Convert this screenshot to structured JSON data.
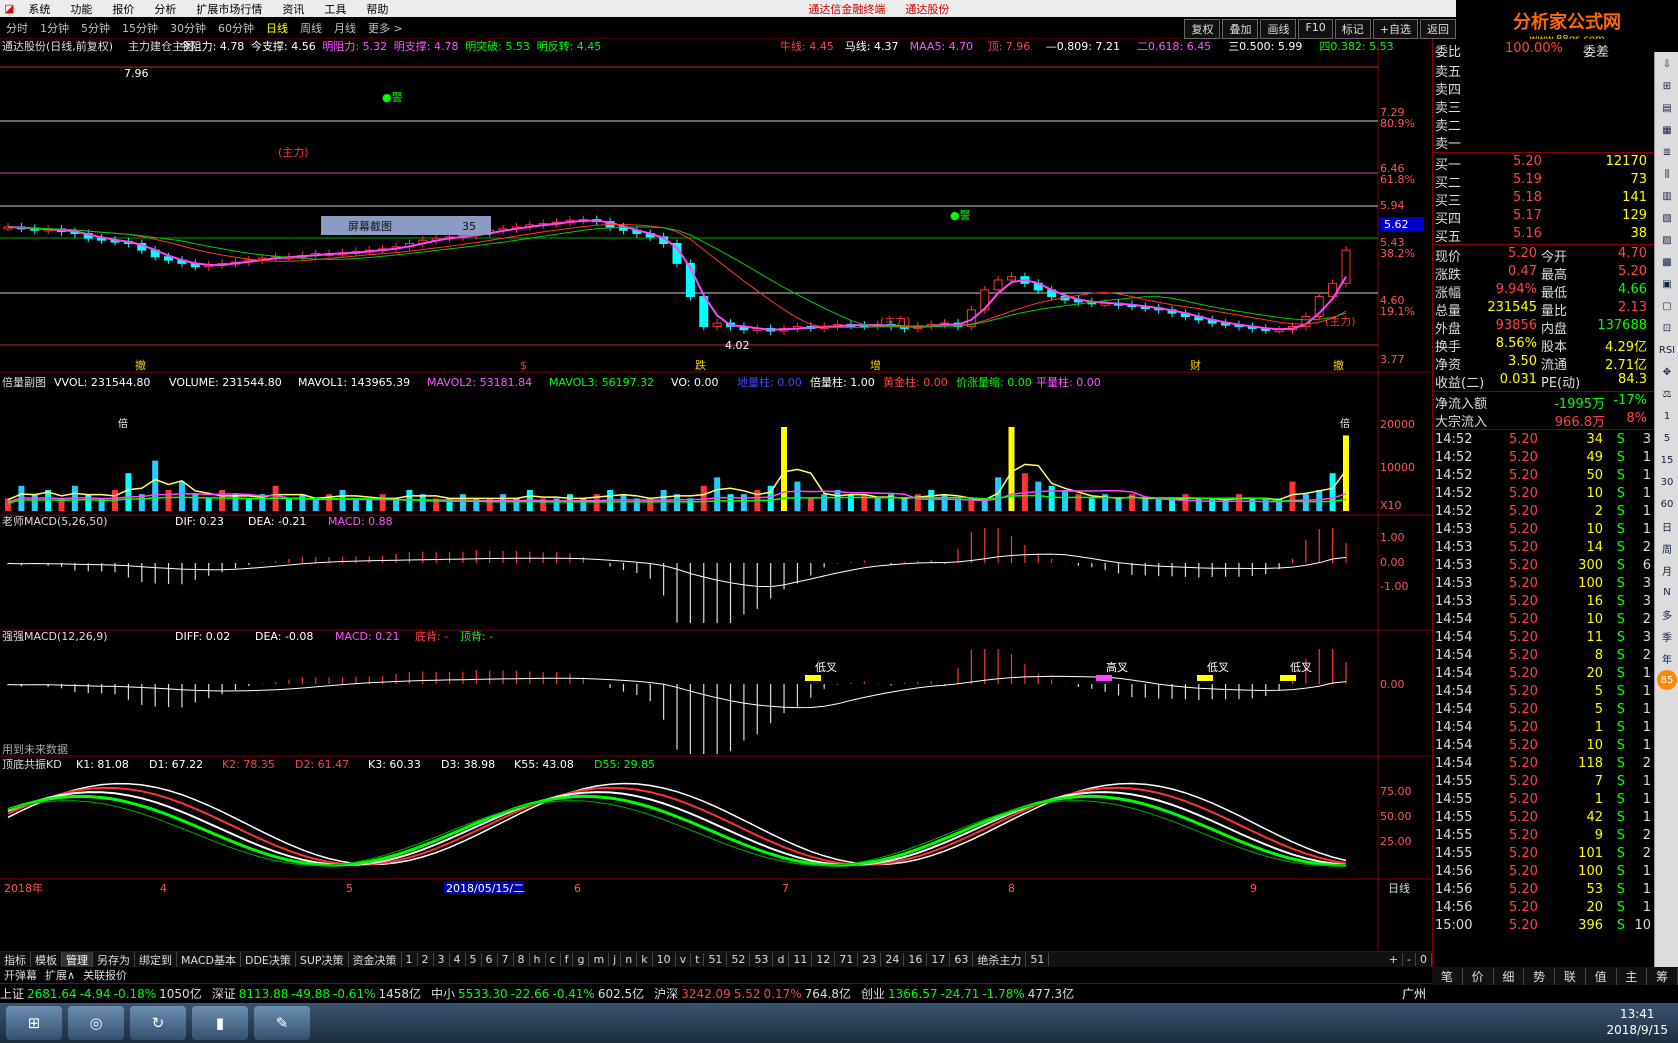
{
  "menu": {
    "items": [
      "系统",
      "功能",
      "报价",
      "分析",
      "扩展市场行情",
      "资讯",
      "工具",
      "帮助"
    ],
    "center": [
      "通达信金融终端",
      "通达股份"
    ]
  },
  "periods": {
    "items": [
      "分时",
      "1分钟",
      "5分钟",
      "15分钟",
      "30分钟",
      "60分钟",
      "日线",
      "周线",
      "月线",
      "更多 >"
    ],
    "selected": "日线"
  },
  "toolbar": {
    "items": [
      "复权",
      "叠加",
      "画线",
      "F10",
      "标记",
      "+自选",
      "返回"
    ]
  },
  "logo": {
    "text": "分析家公式网",
    "url": "www.88gs.com"
  },
  "main_chart": {
    "title": "通达股份(日线,前复权)",
    "legend": [
      {
        "t": "主力建仓主图",
        "c": "#dddddd"
      },
      {
        "t": "今阻力: 4.78",
        "c": "#ffffff"
      },
      {
        "t": "今支撑: 4.56",
        "c": "#ffffff"
      },
      {
        "t": "明阻力: 5.32",
        "c": "#ff55ff"
      },
      {
        "t": "明支撑: 4.78",
        "c": "#ff55ff"
      },
      {
        "t": "明突破: 5.53",
        "c": "#00ff00"
      },
      {
        "t": "明反转: 4.45",
        "c": "#00ff00"
      },
      {
        "t": "牛线: 4.45",
        "c": "#ff4444"
      },
      {
        "t": "马线: 4.37",
        "c": "#ffffff"
      },
      {
        "t": "MAA5: 4.70",
        "c": "#ff55ff"
      },
      {
        "t": "顶: 7.96",
        "c": "#ff4444"
      },
      {
        "t": "—0.809: 7.21",
        "c": "#ffffff"
      },
      {
        "t": "二0.618: 6.45",
        "c": "#ff55ff"
      },
      {
        "t": "三0.500: 5.99",
        "c": "#ffffff"
      },
      {
        "t": "四0.382: 5.53",
        "c": "#00ff00"
      }
    ],
    "price_axis": [
      "7.29",
      "80.9%",
      "6.46",
      "61.8%",
      "5.94",
      "5.43",
      "38.2%",
      "4.60",
      "19.1%",
      "3.77"
    ],
    "crosshair_price": "5.62",
    "high_label": "7.96",
    "low_label": "4.02",
    "marks": [
      "●警",
      "●警"
    ],
    "main_force_label": "(主力)",
    "bottom_signals": [
      "撤",
      "$",
      "跌",
      "增",
      "财",
      "撤"
    ],
    "screenshot_box": {
      "label": "屏幕截图",
      "count": "35"
    }
  },
  "volume": {
    "title": "倍量副图",
    "legend": [
      {
        "t": "VVOL: 231544.80",
        "c": "#ffffff"
      },
      {
        "t": "VOLUME: 231544.80",
        "c": "#ffffff"
      },
      {
        "t": "MAVOL1: 143965.39",
        "c": "#ffffff"
      },
      {
        "t": "MAVOL2: 53181.84",
        "c": "#ff55ff"
      },
      {
        "t": "MAVOL3: 56197.32",
        "c": "#00ff00"
      },
      {
        "t": "VO: 0.00",
        "c": "#ffffff"
      },
      {
        "t": "地量柱: 0.00",
        "c": "#4444ff"
      },
      {
        "t": "倍量柱: 1.00",
        "c": "#ffffff"
      },
      {
        "t": "黄金柱: 0.00",
        "c": "#ff4444"
      },
      {
        "t": "价涨量缩: 0.00",
        "c": "#00ff00"
      },
      {
        "t": "平量柱: 0.00",
        "c": "#ff55ff"
      }
    ],
    "axis": [
      "20000",
      "10000"
    ],
    "unit": "X10",
    "bar_label": "倍"
  },
  "macd1": {
    "title": "老师MACD(5,26,50)",
    "legend": [
      {
        "t": "DIF: 0.23",
        "c": "#ffffff"
      },
      {
        "t": "DEA: -0.21",
        "c": "#ffffff"
      },
      {
        "t": "MACD: 0.88",
        "c": "#ff55ff"
      }
    ],
    "axis": [
      "1.00",
      "0.00",
      "-1.00"
    ]
  },
  "macd2": {
    "title": "强强MACD(12,26,9)",
    "legend": [
      {
        "t": "DIFF: 0.02",
        "c": "#ffffff"
      },
      {
        "t": "DEA: -0.08",
        "c": "#ffffff"
      },
      {
        "t": "MACD: 0.21",
        "c": "#ff55ff"
      },
      {
        "t": "底背: -",
        "c": "#ff4444"
      },
      {
        "t": "顶背: -",
        "c": "#00ff00"
      }
    ],
    "axis": [
      "0.00"
    ],
    "signals": [
      "低叉",
      "高叉",
      "低叉",
      "低叉"
    ],
    "footnote": "用到未来数据"
  },
  "kd": {
    "title": "顶底共振KD",
    "legend": [
      {
        "t": "K1: 81.08",
        "c": "#ffffff"
      },
      {
        "t": "D1: 67.22",
        "c": "#ffffff"
      },
      {
        "t": "K2: 78.35",
        "c": "#ff4444"
      },
      {
        "t": "D2: 61.47",
        "c": "#ff4444"
      },
      {
        "t": "K3: 60.33",
        "c": "#ffffff"
      },
      {
        "t": "D3: 38.98",
        "c": "#ffffff"
      },
      {
        "t": "K55: 43.08",
        "c": "#ffffff"
      },
      {
        "t": "D55: 29.85",
        "c": "#00ff00"
      }
    ],
    "axis": [
      "75.00",
      "50.00",
      "25.00"
    ]
  },
  "date_axis": {
    "year": "2018年",
    "months": [
      "4",
      "5",
      "6",
      "7",
      "8",
      "9"
    ],
    "cursor_date": "2018/05/15/二",
    "period": "日线"
  },
  "bottom_tabs": [
    "指标",
    "模板",
    "管理",
    "另存为",
    "绑定到",
    "MACD基本",
    "DDE决策",
    "SUP决策",
    "资金决策",
    "1",
    "2",
    "3",
    "4",
    "5",
    "6",
    "7",
    "8",
    "h",
    "c",
    "f",
    "g",
    "m",
    "j",
    "n",
    "k",
    "10",
    "v",
    "t",
    "51",
    "52",
    "53",
    "d",
    "11",
    "12",
    "71",
    "23",
    "24",
    "16",
    "17",
    "63",
    "绝杀主力",
    "51"
  ],
  "bottom_tab_selected": "管理",
  "bottom_tabs2": [
    "开弹幕",
    "扩展∧",
    "关联报价"
  ],
  "zoom_buttons": [
    "+",
    "-",
    "0"
  ],
  "quotes": [
    {
      "name": "上证",
      "v": "2681.64",
      "ch": "-4.94",
      "pct": "-0.18%",
      "amt": "1050亿",
      "c": "#00ff00"
    },
    {
      "name": "深证",
      "v": "8113.88",
      "ch": "-49.88",
      "pct": "-0.61%",
      "amt": "1458亿",
      "c": "#00ff00"
    },
    {
      "name": "中小",
      "v": "5533.30",
      "ch": "-22.66",
      "pct": "-0.41%",
      "amt": "602.5亿",
      "c": "#00ff00"
    },
    {
      "name": "沪深",
      "v": "3242.09",
      "ch": "5.52",
      "pct": "0.17%",
      "amt": "764.8亿",
      "c": "#ff4444"
    },
    {
      "name": "创业",
      "v": "1366.57",
      "ch": "-24.71",
      "pct": "-1.78%",
      "amt": "477.3亿",
      "c": "#00ff00"
    }
  ],
  "city": "广州",
  "order_book": {
    "weibi_label": "委比",
    "weibi_vals": "100.00%",
    "weicha": "委差",
    "sells": [
      {
        "l": "卖五"
      },
      {
        "l": "卖四"
      },
      {
        "l": "卖三"
      },
      {
        "l": "卖二"
      },
      {
        "l": "卖一"
      }
    ],
    "buys": [
      {
        "l": "买一",
        "p": "5.20",
        "v": "12170"
      },
      {
        "l": "买二",
        "p": "5.19",
        "v": "73"
      },
      {
        "l": "买三",
        "p": "5.18",
        "v": "141"
      },
      {
        "l": "买四",
        "p": "5.17",
        "v": "129"
      },
      {
        "l": "买五",
        "p": "5.16",
        "v": "38"
      }
    ]
  },
  "stats": [
    {
      "l": "现价",
      "v": "5.20",
      "vc": "#ff4444",
      "l2": "今开",
      "v2": "4.70",
      "v2c": "#ff4444"
    },
    {
      "l": "涨跌",
      "v": "0.47",
      "vc": "#ff4444",
      "l2": "最高",
      "v2": "5.20",
      "v2c": "#ff4444"
    },
    {
      "l": "涨幅",
      "v": "9.94%",
      "vc": "#ff4444",
      "l2": "最低",
      "v2": "4.66",
      "v2c": "#00ff00"
    },
    {
      "l": "总量",
      "v": "231545",
      "vc": "#ffff00",
      "l2": "量比",
      "v2": "2.13",
      "v2c": "#ff4444"
    },
    {
      "l": "外盘",
      "v": "93856",
      "vc": "#ff4444",
      "l2": "内盘",
      "v2": "137688",
      "v2c": "#00ff00"
    },
    {
      "l": "换手",
      "v": "8.56%",
      "vc": "#ffff00",
      "l2": "股本",
      "v2": "4.29亿",
      "v2c": "#ffff00"
    },
    {
      "l": "净资",
      "v": "3.50",
      "vc": "#ffff00",
      "l2": "流通",
      "v2": "2.71亿",
      "v2c": "#ffff00"
    },
    {
      "l": "收益(二)",
      "v": "0.031",
      "vc": "#ffff00",
      "l2": "PE(动)",
      "v2": "84.3",
      "v2c": "#ffff00"
    }
  ],
  "flows": [
    {
      "l": "净流入额",
      "v": "-1995万",
      "p": "-17%",
      "c": "#00ff00"
    },
    {
      "l": "大宗流入",
      "v": "966.8万",
      "p": "8%",
      "c": "#ff4444"
    }
  ],
  "ticks": [
    [
      "14:52",
      "5.20",
      "34",
      "S",
      "3"
    ],
    [
      "14:52",
      "5.20",
      "49",
      "S",
      "1"
    ],
    [
      "14:52",
      "5.20",
      "50",
      "S",
      "1"
    ],
    [
      "14:52",
      "5.20",
      "10",
      "S",
      "1"
    ],
    [
      "14:52",
      "5.20",
      "2",
      "S",
      "1"
    ],
    [
      "14:53",
      "5.20",
      "10",
      "S",
      "1"
    ],
    [
      "14:53",
      "5.20",
      "14",
      "S",
      "2"
    ],
    [
      "14:53",
      "5.20",
      "300",
      "S",
      "6"
    ],
    [
      "14:53",
      "5.20",
      "100",
      "S",
      "3"
    ],
    [
      "14:53",
      "5.20",
      "16",
      "S",
      "3"
    ],
    [
      "14:54",
      "5.20",
      "10",
      "S",
      "2"
    ],
    [
      "14:54",
      "5.20",
      "11",
      "S",
      "3"
    ],
    [
      "14:54",
      "5.20",
      "8",
      "S",
      "2"
    ],
    [
      "14:54",
      "5.20",
      "20",
      "S",
      "1"
    ],
    [
      "14:54",
      "5.20",
      "5",
      "S",
      "1"
    ],
    [
      "14:54",
      "5.20",
      "5",
      "S",
      "1"
    ],
    [
      "14:54",
      "5.20",
      "1",
      "S",
      "1"
    ],
    [
      "14:54",
      "5.20",
      "10",
      "S",
      "1"
    ],
    [
      "14:54",
      "5.20",
      "118",
      "S",
      "2"
    ],
    [
      "14:55",
      "5.20",
      "7",
      "S",
      "1"
    ],
    [
      "14:55",
      "5.20",
      "1",
      "S",
      "1"
    ],
    [
      "14:55",
      "5.20",
      "42",
      "S",
      "1"
    ],
    [
      "14:55",
      "5.20",
      "9",
      "S",
      "2"
    ],
    [
      "14:55",
      "5.20",
      "101",
      "S",
      "2"
    ],
    [
      "14:56",
      "5.20",
      "100",
      "S",
      "1"
    ],
    [
      "14:56",
      "5.20",
      "53",
      "S",
      "1"
    ],
    [
      "14:56",
      "5.20",
      "20",
      "S",
      "1"
    ],
    [
      "15:00",
      "5.20",
      "396",
      "S",
      "10"
    ]
  ],
  "right_tabs": [
    "笔",
    "价",
    "细",
    "势",
    "联",
    "值",
    "主",
    "筹"
  ],
  "sidebar_icons": [
    "⇩",
    "⊞",
    "▤",
    "▦",
    "≣",
    "⫼",
    "▥",
    "▧",
    "▨",
    "▩",
    "▣",
    "▢",
    "⊡",
    "RSI",
    "✥",
    "⚖"
  ],
  "sidebar_numbers": [
    "1",
    "5",
    "15",
    "30",
    "60",
    "日",
    "周",
    "月",
    "N",
    "多",
    "季",
    "年"
  ],
  "badge": "85",
  "clock": {
    "time": "13:41",
    "date": "2018/9/15"
  }
}
